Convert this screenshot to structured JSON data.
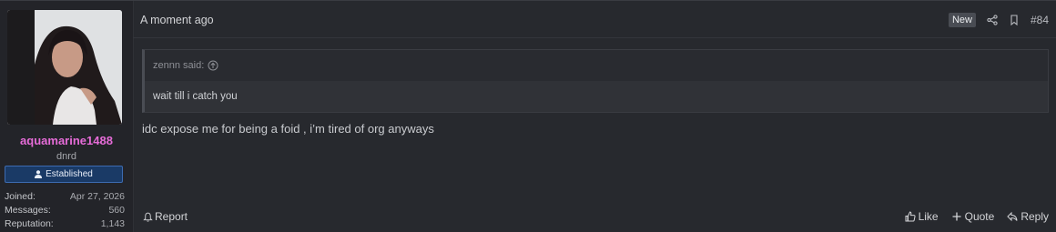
{
  "user": {
    "username": "aquamarine1488",
    "user_title": "dnrd",
    "banner": "Established",
    "stats": [
      {
        "label": "Joined:",
        "value": "Apr 27, 2026"
      },
      {
        "label": "Messages:",
        "value": "560"
      },
      {
        "label": "Reputation:",
        "value": "1,143"
      }
    ]
  },
  "header": {
    "timestamp": "A moment ago",
    "badge": "New",
    "post_number": "#84"
  },
  "quote": {
    "author_line": "zennn said:",
    "text": "wait till i catch you"
  },
  "message": "idc expose me for being a foid , i’m tired of org anyways",
  "footer": {
    "report": "Report",
    "like": "Like",
    "quote": "Quote",
    "reply": "Reply"
  },
  "colors": {
    "username": "#e66cd8",
    "banner_bg": "#1a3a66",
    "background": "#27292e"
  }
}
